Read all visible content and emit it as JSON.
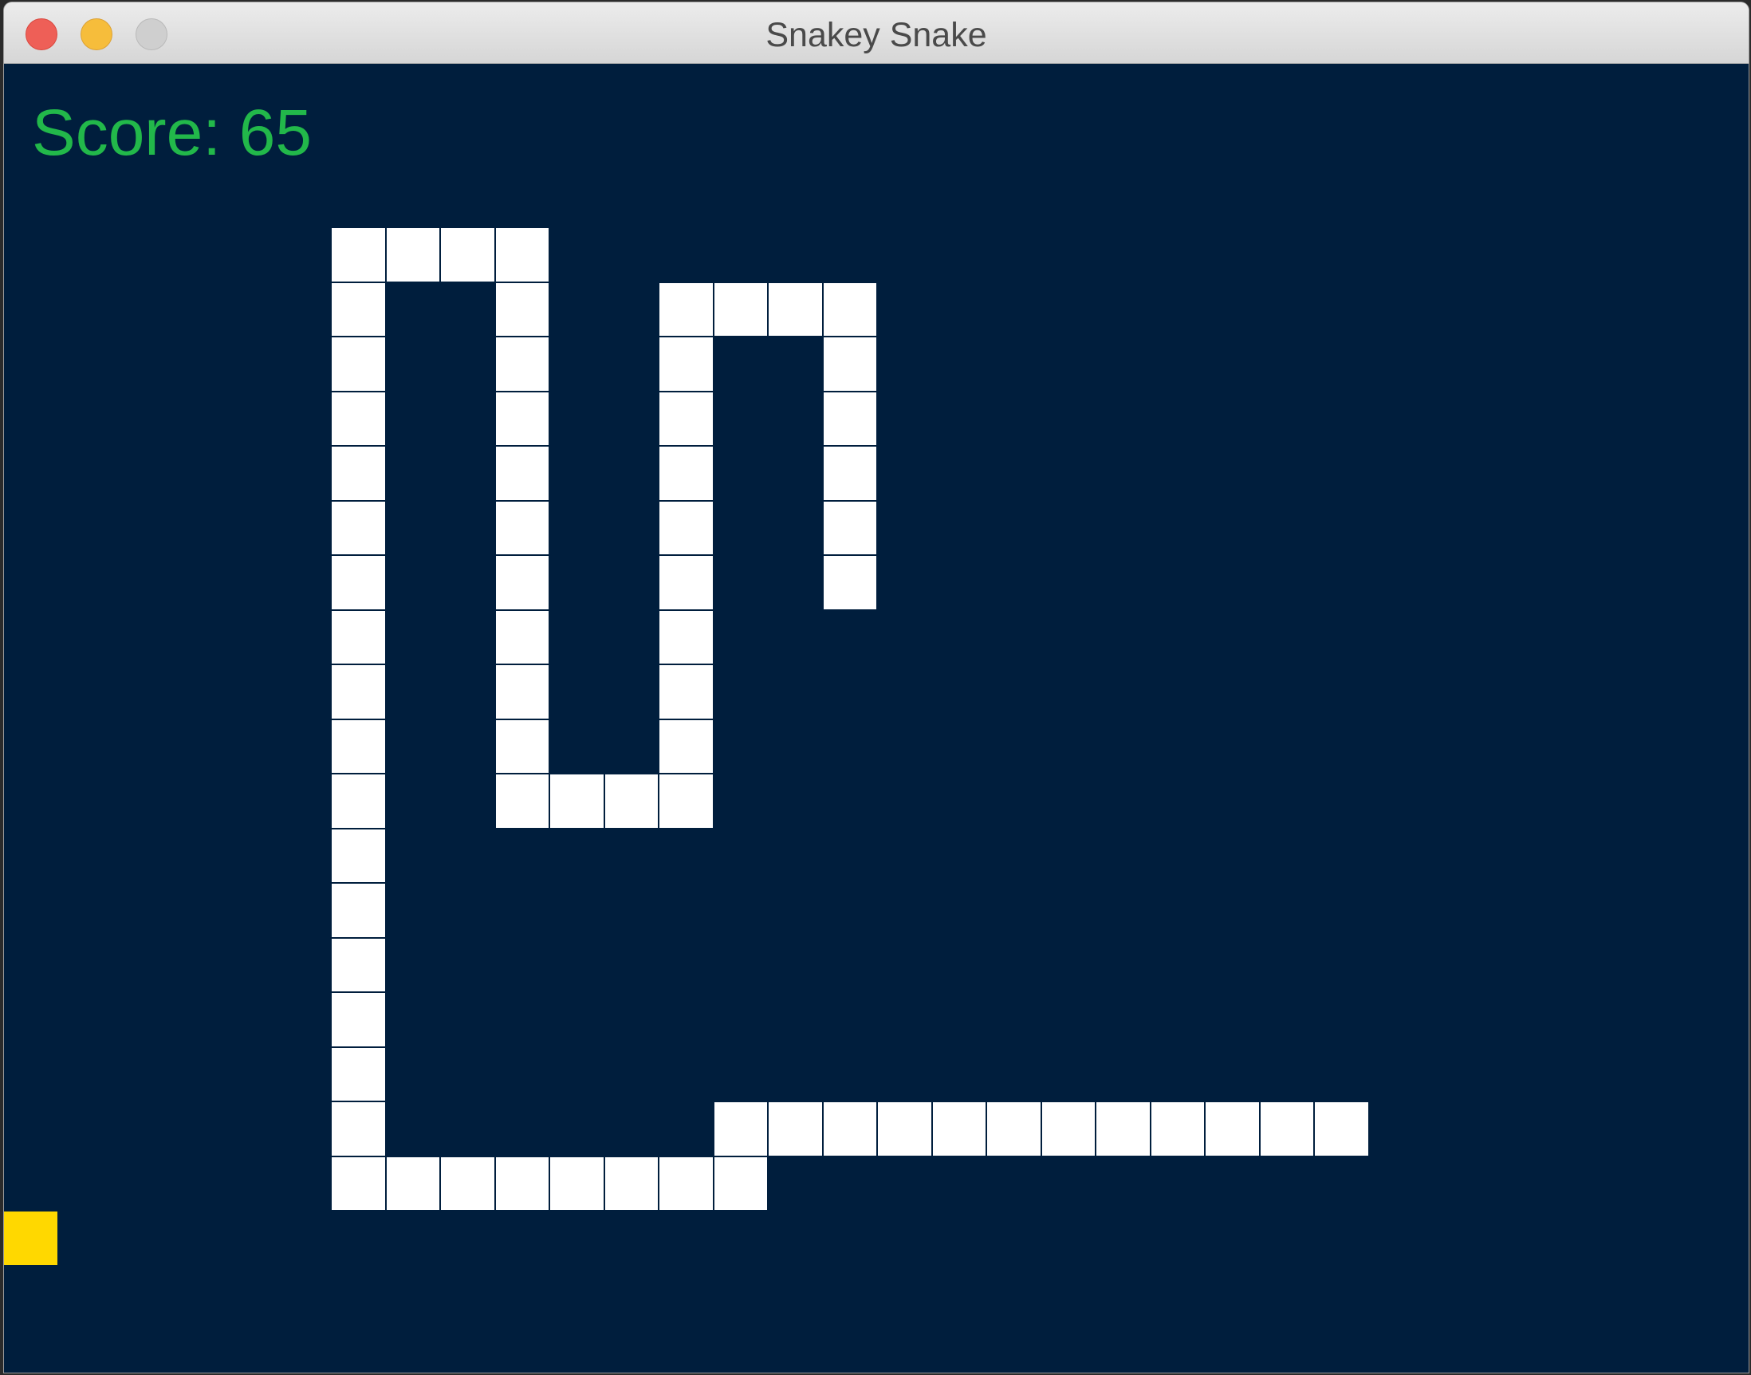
{
  "window": {
    "title": "Snakey Snake"
  },
  "hud": {
    "score_label": "Score:",
    "score_value": "65"
  },
  "colors": {
    "background": "#001e3d",
    "snake": "#ffffff",
    "food": "#ffd800",
    "score_text": "#22b84a"
  },
  "game": {
    "snake_segments": [
      [
        0,
        0
      ],
      [
        1,
        0
      ],
      [
        2,
        0
      ],
      [
        3,
        0
      ],
      [
        0,
        1
      ],
      [
        0,
        2
      ],
      [
        0,
        3
      ],
      [
        0,
        4
      ],
      [
        0,
        5
      ],
      [
        0,
        6
      ],
      [
        0,
        7
      ],
      [
        0,
        8
      ],
      [
        0,
        9
      ],
      [
        0,
        10
      ],
      [
        0,
        11
      ],
      [
        0,
        12
      ],
      [
        0,
        13
      ],
      [
        0,
        14
      ],
      [
        0,
        15
      ],
      [
        0,
        16
      ],
      [
        0,
        17
      ],
      [
        1,
        17
      ],
      [
        2,
        17
      ],
      [
        3,
        17
      ],
      [
        4,
        17
      ],
      [
        5,
        17
      ],
      [
        6,
        17
      ],
      [
        7,
        17
      ],
      [
        7,
        16
      ],
      [
        8,
        16
      ],
      [
        9,
        16
      ],
      [
        10,
        16
      ],
      [
        11,
        16
      ],
      [
        12,
        16
      ],
      [
        13,
        16
      ],
      [
        14,
        16
      ],
      [
        15,
        16
      ],
      [
        16,
        16
      ],
      [
        17,
        16
      ],
      [
        18,
        16
      ],
      [
        3,
        1
      ],
      [
        3,
        2
      ],
      [
        3,
        3
      ],
      [
        3,
        4
      ],
      [
        3,
        5
      ],
      [
        3,
        6
      ],
      [
        3,
        7
      ],
      [
        3,
        8
      ],
      [
        3,
        9
      ],
      [
        3,
        10
      ],
      [
        4,
        10
      ],
      [
        5,
        10
      ],
      [
        6,
        10
      ],
      [
        6,
        9
      ],
      [
        6,
        8
      ],
      [
        6,
        7
      ],
      [
        6,
        6
      ],
      [
        6,
        5
      ],
      [
        6,
        4
      ],
      [
        6,
        3
      ],
      [
        6,
        2
      ],
      [
        6,
        1
      ],
      [
        7,
        1
      ],
      [
        8,
        1
      ],
      [
        9,
        1
      ],
      [
        9,
        2
      ],
      [
        9,
        3
      ],
      [
        9,
        4
      ],
      [
        9,
        5
      ],
      [
        9,
        6
      ]
    ],
    "food": [
      -6,
      18
    ]
  }
}
